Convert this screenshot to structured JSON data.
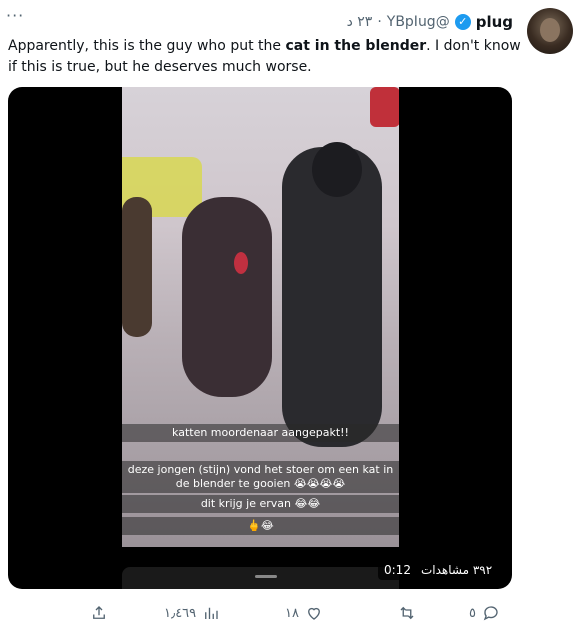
{
  "author": {
    "name": "plug",
    "handle": "@YBpIug",
    "separator": "·",
    "time": "٢٣ د"
  },
  "more_label": "···",
  "tweet": {
    "part1": "Apparently, this is the guy who put the ",
    "bold": "cat in the blender",
    "part2": ". I don't know if this is true, but he deserves much worse."
  },
  "video": {
    "captions": [
      "katten moordenaar aangepakt!!",
      "deze jongen (stijn) vond het stoer om een kat in",
      "de blender te gooien 😭😭😭😭",
      "dit krijg je ervan 😂😂",
      "🖕😂"
    ],
    "duration": "0:12",
    "views": "٣٩٢ مشاهدات"
  },
  "actions": {
    "replies": "٥",
    "likes": "١٨",
    "views": "١٫٤٦٩"
  },
  "colors": {
    "verified": "#1d9bf0",
    "muted": "#536471"
  }
}
